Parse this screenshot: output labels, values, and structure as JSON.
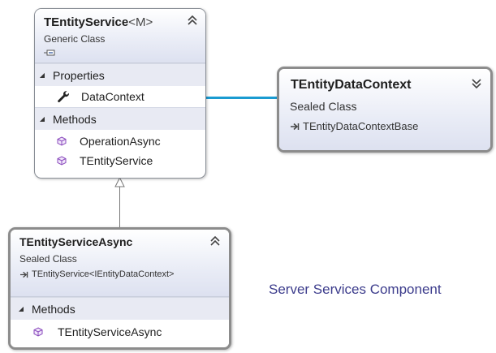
{
  "classes": {
    "tentity_service": {
      "name": "TEntityService",
      "generic": "<M>",
      "kind": "Generic Class",
      "properties_label": "Properties",
      "properties": [
        "DataContext"
      ],
      "methods_label": "Methods",
      "methods": [
        "OperationAsync",
        "TEntityService"
      ]
    },
    "tentity_data_context": {
      "name": "TEntityDataContext",
      "kind": "Sealed Class",
      "base": "TEntityDataContextBase"
    },
    "tentity_service_async": {
      "name": "TEntityServiceAsync",
      "kind": "Sealed Class",
      "base": "TEntityService<IEntityDataContext>",
      "methods_label": "Methods",
      "methods": [
        "TEntityServiceAsync"
      ]
    }
  },
  "caption": "Server Services Component",
  "colors": {
    "association_line": "#1a9bd1",
    "caption_text": "#3c3c8c",
    "method_icon": "#8a4bbd"
  }
}
